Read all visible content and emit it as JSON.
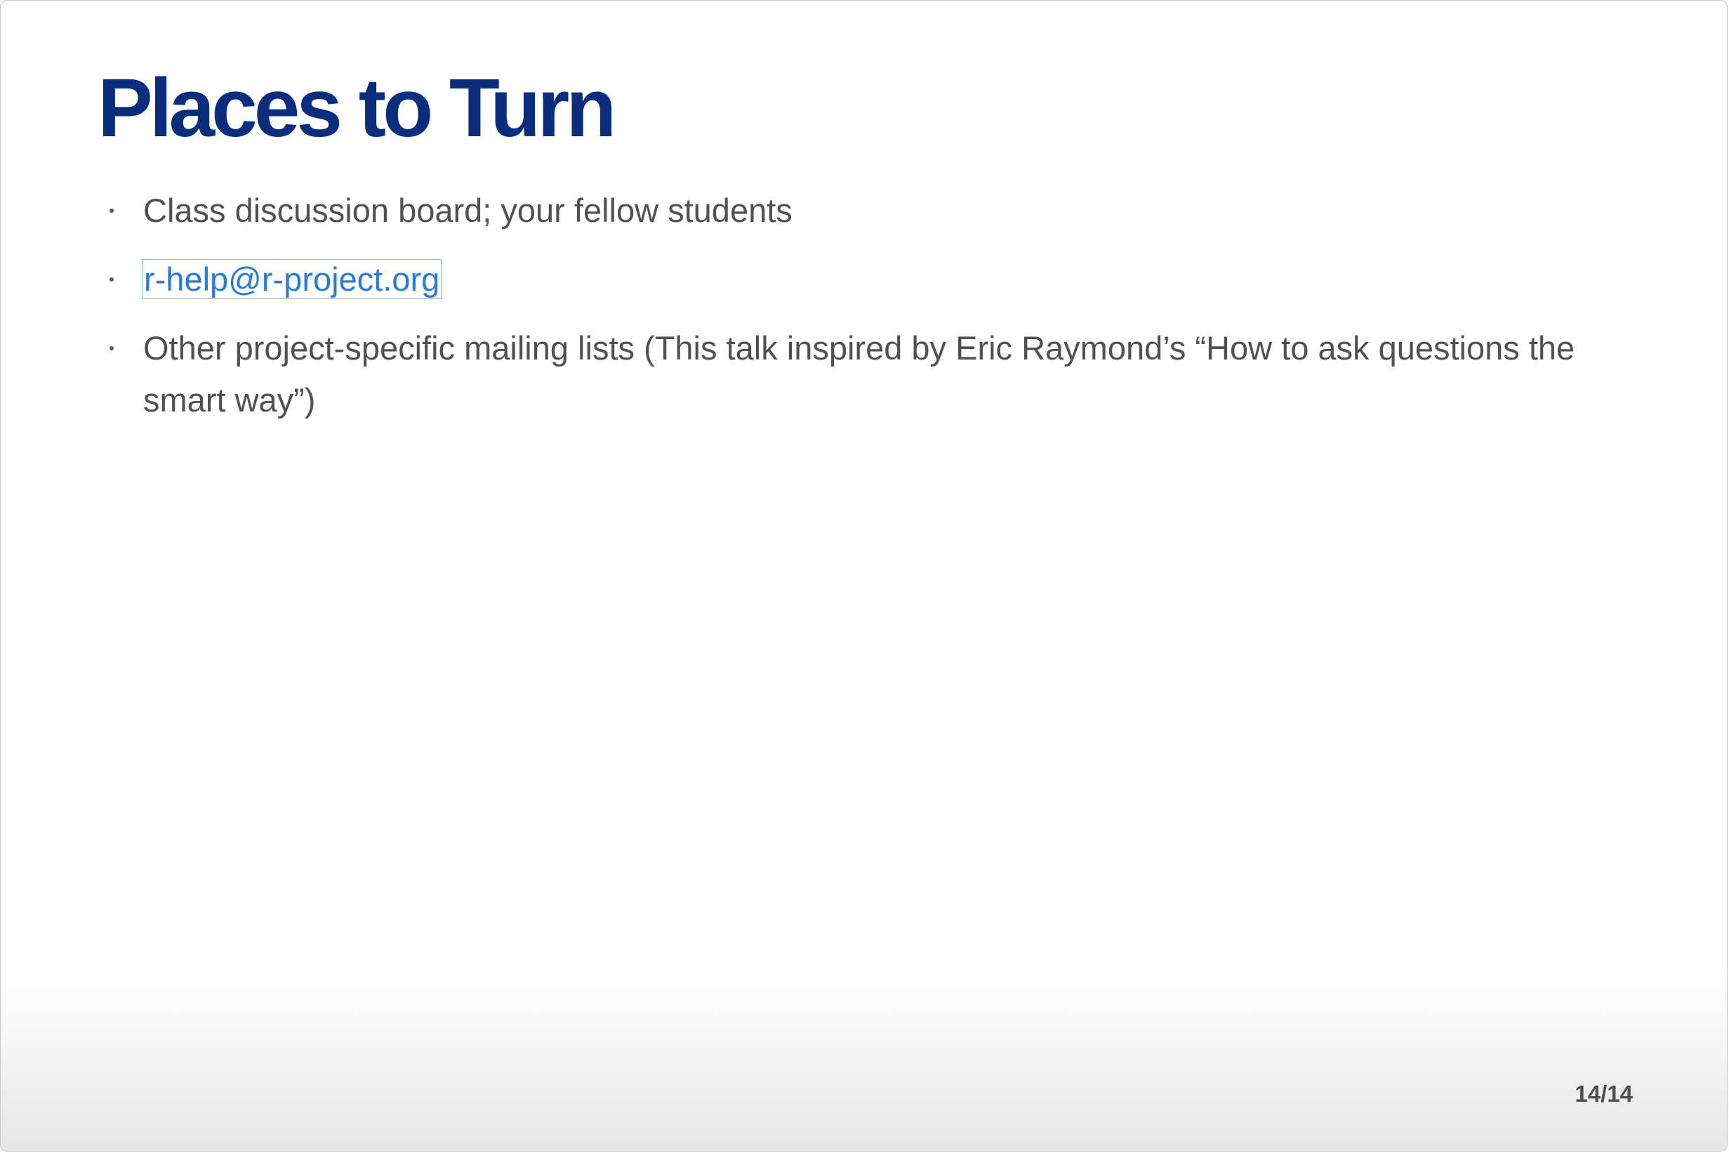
{
  "slide": {
    "title": "Places to Turn",
    "bullets": [
      {
        "text": "Class discussion board; your fellow students"
      },
      {
        "text": "r-help@r-project.org",
        "is_link": true
      },
      {
        "text": "Other project-specific mailing lists (This talk inspired by Eric Raymond’s “How to ask questions the smart way”)"
      }
    ],
    "page_number": "14/14"
  },
  "colors": {
    "title": "#0b2d7e",
    "body_text": "#515151",
    "link": "#2a7ad8"
  }
}
